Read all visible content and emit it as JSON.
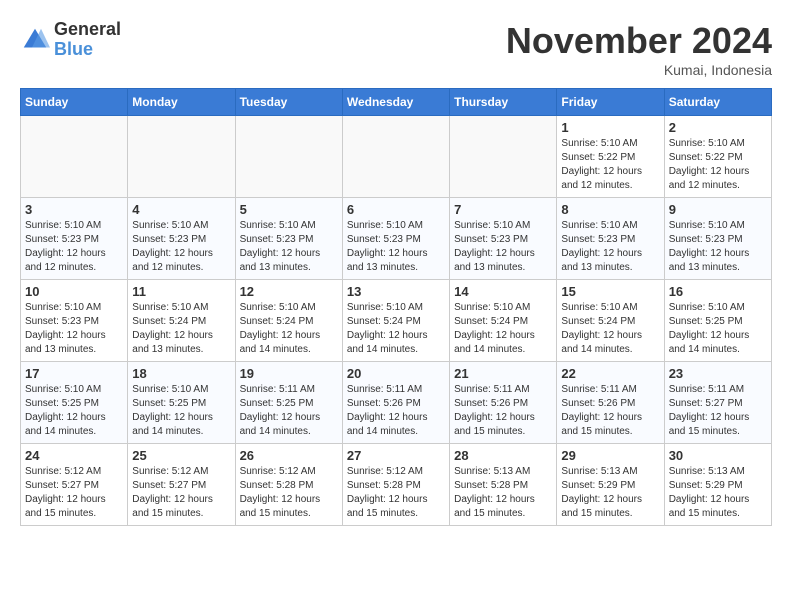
{
  "logo": {
    "general": "General",
    "blue": "Blue"
  },
  "header": {
    "title": "November 2024",
    "subtitle": "Kumai, Indonesia"
  },
  "weekdays": [
    "Sunday",
    "Monday",
    "Tuesday",
    "Wednesday",
    "Thursday",
    "Friday",
    "Saturday"
  ],
  "weeks": [
    [
      {
        "day": "",
        "empty": true
      },
      {
        "day": "",
        "empty": true
      },
      {
        "day": "",
        "empty": true
      },
      {
        "day": "",
        "empty": true
      },
      {
        "day": "",
        "empty": true
      },
      {
        "day": "1",
        "lines": [
          "Sunrise: 5:10 AM",
          "Sunset: 5:22 PM",
          "Daylight: 12 hours",
          "and 12 minutes."
        ]
      },
      {
        "day": "2",
        "lines": [
          "Sunrise: 5:10 AM",
          "Sunset: 5:22 PM",
          "Daylight: 12 hours",
          "and 12 minutes."
        ]
      }
    ],
    [
      {
        "day": "3",
        "lines": [
          "Sunrise: 5:10 AM",
          "Sunset: 5:23 PM",
          "Daylight: 12 hours",
          "and 12 minutes."
        ]
      },
      {
        "day": "4",
        "lines": [
          "Sunrise: 5:10 AM",
          "Sunset: 5:23 PM",
          "Daylight: 12 hours",
          "and 12 minutes."
        ]
      },
      {
        "day": "5",
        "lines": [
          "Sunrise: 5:10 AM",
          "Sunset: 5:23 PM",
          "Daylight: 12 hours",
          "and 13 minutes."
        ]
      },
      {
        "day": "6",
        "lines": [
          "Sunrise: 5:10 AM",
          "Sunset: 5:23 PM",
          "Daylight: 12 hours",
          "and 13 minutes."
        ]
      },
      {
        "day": "7",
        "lines": [
          "Sunrise: 5:10 AM",
          "Sunset: 5:23 PM",
          "Daylight: 12 hours",
          "and 13 minutes."
        ]
      },
      {
        "day": "8",
        "lines": [
          "Sunrise: 5:10 AM",
          "Sunset: 5:23 PM",
          "Daylight: 12 hours",
          "and 13 minutes."
        ]
      },
      {
        "day": "9",
        "lines": [
          "Sunrise: 5:10 AM",
          "Sunset: 5:23 PM",
          "Daylight: 12 hours",
          "and 13 minutes."
        ]
      }
    ],
    [
      {
        "day": "10",
        "lines": [
          "Sunrise: 5:10 AM",
          "Sunset: 5:23 PM",
          "Daylight: 12 hours",
          "and 13 minutes."
        ]
      },
      {
        "day": "11",
        "lines": [
          "Sunrise: 5:10 AM",
          "Sunset: 5:24 PM",
          "Daylight: 12 hours",
          "and 13 minutes."
        ]
      },
      {
        "day": "12",
        "lines": [
          "Sunrise: 5:10 AM",
          "Sunset: 5:24 PM",
          "Daylight: 12 hours",
          "and 14 minutes."
        ]
      },
      {
        "day": "13",
        "lines": [
          "Sunrise: 5:10 AM",
          "Sunset: 5:24 PM",
          "Daylight: 12 hours",
          "and 14 minutes."
        ]
      },
      {
        "day": "14",
        "lines": [
          "Sunrise: 5:10 AM",
          "Sunset: 5:24 PM",
          "Daylight: 12 hours",
          "and 14 minutes."
        ]
      },
      {
        "day": "15",
        "lines": [
          "Sunrise: 5:10 AM",
          "Sunset: 5:24 PM",
          "Daylight: 12 hours",
          "and 14 minutes."
        ]
      },
      {
        "day": "16",
        "lines": [
          "Sunrise: 5:10 AM",
          "Sunset: 5:25 PM",
          "Daylight: 12 hours",
          "and 14 minutes."
        ]
      }
    ],
    [
      {
        "day": "17",
        "lines": [
          "Sunrise: 5:10 AM",
          "Sunset: 5:25 PM",
          "Daylight: 12 hours",
          "and 14 minutes."
        ]
      },
      {
        "day": "18",
        "lines": [
          "Sunrise: 5:10 AM",
          "Sunset: 5:25 PM",
          "Daylight: 12 hours",
          "and 14 minutes."
        ]
      },
      {
        "day": "19",
        "lines": [
          "Sunrise: 5:11 AM",
          "Sunset: 5:25 PM",
          "Daylight: 12 hours",
          "and 14 minutes."
        ]
      },
      {
        "day": "20",
        "lines": [
          "Sunrise: 5:11 AM",
          "Sunset: 5:26 PM",
          "Daylight: 12 hours",
          "and 14 minutes."
        ]
      },
      {
        "day": "21",
        "lines": [
          "Sunrise: 5:11 AM",
          "Sunset: 5:26 PM",
          "Daylight: 12 hours",
          "and 15 minutes."
        ]
      },
      {
        "day": "22",
        "lines": [
          "Sunrise: 5:11 AM",
          "Sunset: 5:26 PM",
          "Daylight: 12 hours",
          "and 15 minutes."
        ]
      },
      {
        "day": "23",
        "lines": [
          "Sunrise: 5:11 AM",
          "Sunset: 5:27 PM",
          "Daylight: 12 hours",
          "and 15 minutes."
        ]
      }
    ],
    [
      {
        "day": "24",
        "lines": [
          "Sunrise: 5:12 AM",
          "Sunset: 5:27 PM",
          "Daylight: 12 hours",
          "and 15 minutes."
        ]
      },
      {
        "day": "25",
        "lines": [
          "Sunrise: 5:12 AM",
          "Sunset: 5:27 PM",
          "Daylight: 12 hours",
          "and 15 minutes."
        ]
      },
      {
        "day": "26",
        "lines": [
          "Sunrise: 5:12 AM",
          "Sunset: 5:28 PM",
          "Daylight: 12 hours",
          "and 15 minutes."
        ]
      },
      {
        "day": "27",
        "lines": [
          "Sunrise: 5:12 AM",
          "Sunset: 5:28 PM",
          "Daylight: 12 hours",
          "and 15 minutes."
        ]
      },
      {
        "day": "28",
        "lines": [
          "Sunrise: 5:13 AM",
          "Sunset: 5:28 PM",
          "Daylight: 12 hours",
          "and 15 minutes."
        ]
      },
      {
        "day": "29",
        "lines": [
          "Sunrise: 5:13 AM",
          "Sunset: 5:29 PM",
          "Daylight: 12 hours",
          "and 15 minutes."
        ]
      },
      {
        "day": "30",
        "lines": [
          "Sunrise: 5:13 AM",
          "Sunset: 5:29 PM",
          "Daylight: 12 hours",
          "and 15 minutes."
        ]
      }
    ]
  ]
}
